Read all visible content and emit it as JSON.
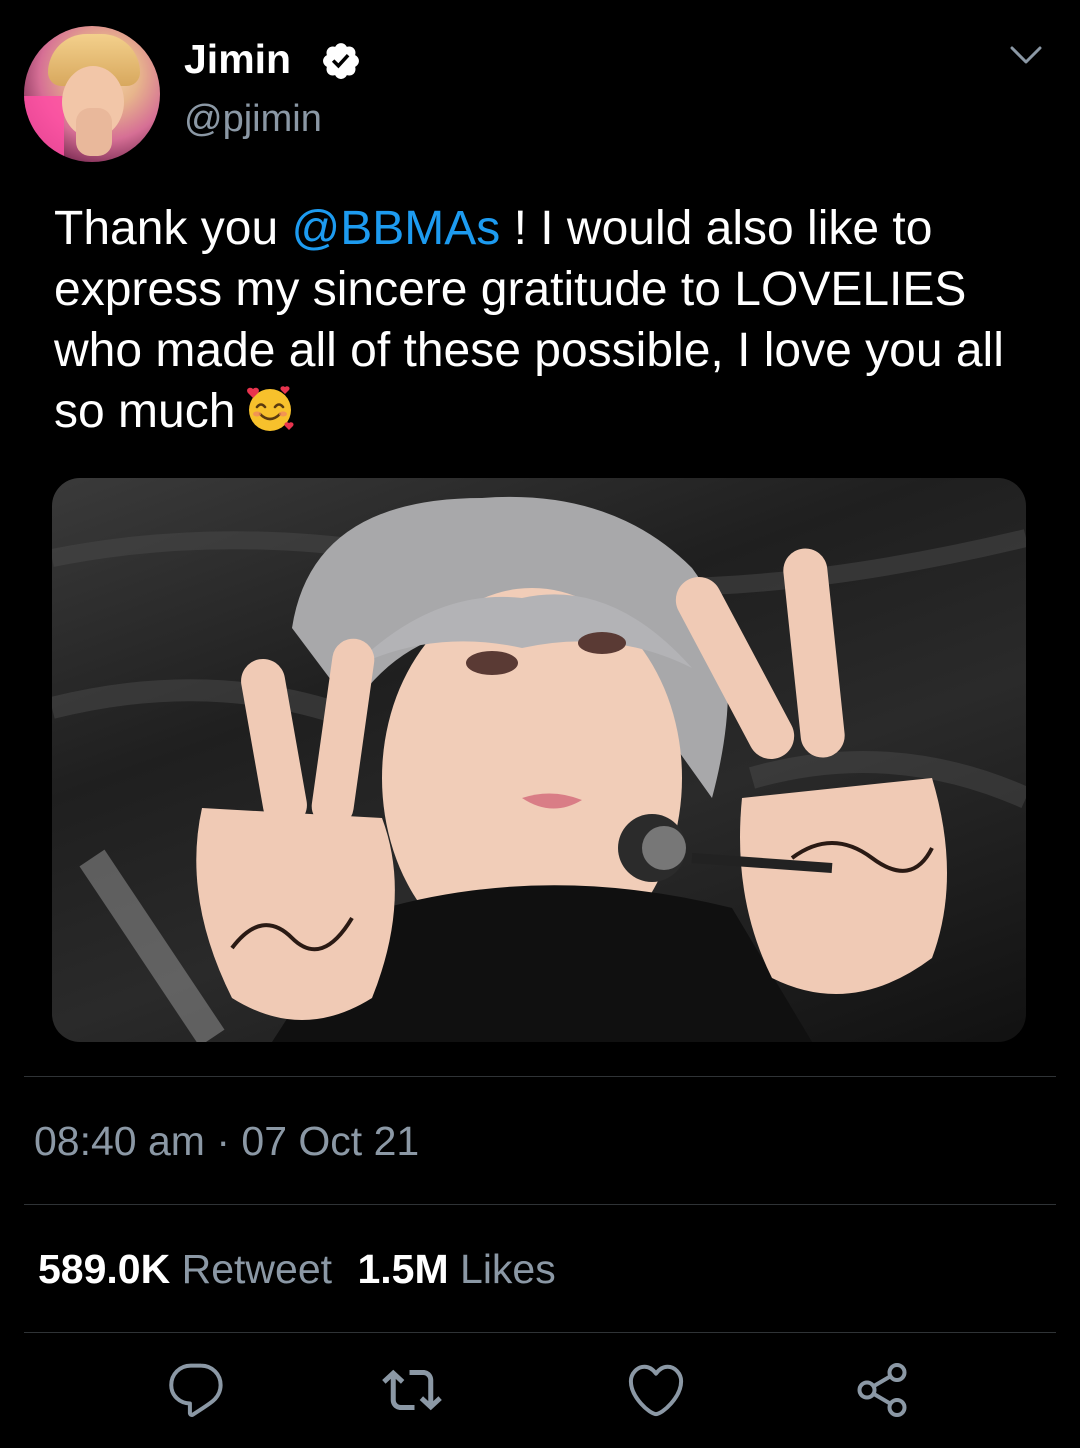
{
  "author": {
    "name": "Jimin",
    "handle": "@pjimin",
    "verified": true,
    "avatar_icon": "profile-photo"
  },
  "tweet": {
    "text_before_mention": "Thank you ",
    "mention": "@BBMAs",
    "text_after_mention": " ! I would also like to express my sincere gratitude to LOVELIES who made all of these possible, I love you all so much",
    "emoji": "smiling-face-with-hearts-emoji"
  },
  "meta": {
    "time": "08:40 am",
    "separator": "·",
    "date": "07 Oct 21"
  },
  "stats": {
    "retweets_count": "589.0K",
    "retweets_label": "Retweet",
    "likes_count": "1.5M",
    "likes_label": "Likes"
  },
  "actions": [
    "reply-icon",
    "retweet-icon",
    "like-icon",
    "share-icon"
  ],
  "colors": {
    "background": "#000000",
    "text": "#ffffff",
    "secondary_text": "#8b98a5",
    "link": "#1d9bf0",
    "divider": "#2f3336"
  }
}
